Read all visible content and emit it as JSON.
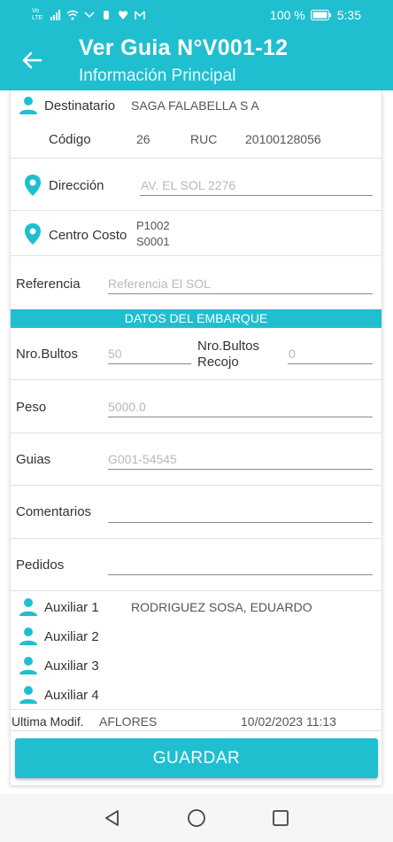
{
  "status": {
    "battery": "100 %",
    "time": "5:35",
    "volte": "Vo LTE"
  },
  "header": {
    "title": "Ver Guia N°V001-12",
    "subtitle": "Información Principal"
  },
  "destinatario": {
    "label": "Destinatario",
    "value": "SAGA FALABELLA S A"
  },
  "codigo": {
    "label": "Código",
    "value": "26"
  },
  "ruc": {
    "label": "RUC",
    "value": "20100128056"
  },
  "direccion": {
    "label": "Dirección",
    "value": "AV. EL SOL 2276"
  },
  "centro_costo": {
    "label": "Centro Costo",
    "line1": "P1002",
    "line2": "S0001"
  },
  "referencia": {
    "label": "Referencia",
    "value": "Referencia El SOL"
  },
  "section": {
    "embarque": "DATOS DEL EMBARQUE"
  },
  "nro_bultos": {
    "label": "Nro.Bultos",
    "value": "50"
  },
  "nro_bultos_recojo": {
    "label": "Nro.Bultos Recojo",
    "value": "0"
  },
  "peso": {
    "label": "Peso",
    "value": "5000.0"
  },
  "guias": {
    "label": "Guias",
    "value": "G001-54545"
  },
  "comentarios": {
    "label": "Comentarios",
    "value": ""
  },
  "pedidos": {
    "label": "Pedidos",
    "value": ""
  },
  "auxiliares": [
    {
      "label": "Auxiliar 1",
      "value": "RODRIGUEZ SOSA, EDUARDO"
    },
    {
      "label": "Auxiliar 2",
      "value": ""
    },
    {
      "label": "Auxiliar 3",
      "value": ""
    },
    {
      "label": "Auxiliar 4",
      "value": ""
    }
  ],
  "ultima": {
    "label": "Ultima Modif.",
    "user": "AFLORES",
    "date": "10/02/2023 11:13"
  },
  "actions": {
    "save": "GUARDAR"
  },
  "colors": {
    "accent": "#1fbfd0"
  },
  "icons": [
    "back-arrow-icon",
    "person-icon",
    "location-pin-icon",
    "nav-back-icon",
    "nav-home-icon",
    "nav-recents-icon"
  ]
}
